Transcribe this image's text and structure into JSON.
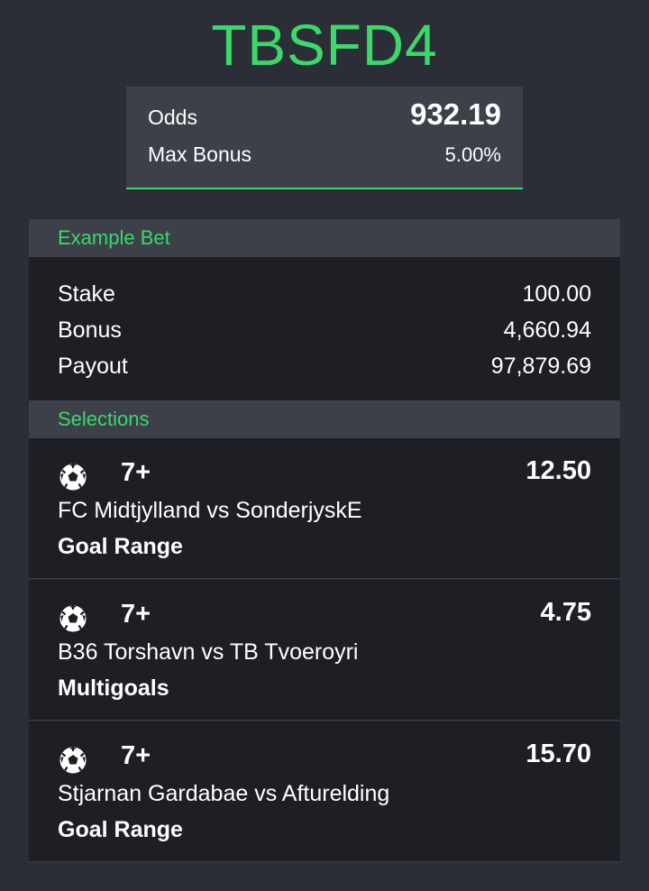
{
  "header": {
    "code": "TBSFD4"
  },
  "summary": {
    "odds_label": "Odds",
    "odds_value": "932.19",
    "bonus_label": "Max Bonus",
    "bonus_value": "5.00%"
  },
  "example_bet": {
    "title": "Example Bet",
    "rows": [
      {
        "label": "Stake",
        "value": "100.00"
      },
      {
        "label": "Bonus",
        "value": "4,660.94"
      },
      {
        "label": "Payout",
        "value": "97,879.69"
      }
    ]
  },
  "selections": {
    "title": "Selections",
    "items": [
      {
        "icon": "soccer-ball-icon",
        "pick": "7+",
        "odds": "12.50",
        "match": "FC Midtjylland vs SonderjyskE",
        "market": "Goal Range"
      },
      {
        "icon": "soccer-ball-icon",
        "pick": "7+",
        "odds": "4.75",
        "match": "B36 Torshavn vs TB Tvoeroyri",
        "market": "Multigoals"
      },
      {
        "icon": "soccer-ball-icon",
        "pick": "7+",
        "odds": "15.70",
        "match": "Stjarnan Gardabae vs Afturelding",
        "market": "Goal Range"
      }
    ]
  },
  "colors": {
    "accent": "#3ad96a",
    "background": "#2b2e36",
    "panel": "#1d1f25",
    "header_bar": "#3d4049"
  }
}
